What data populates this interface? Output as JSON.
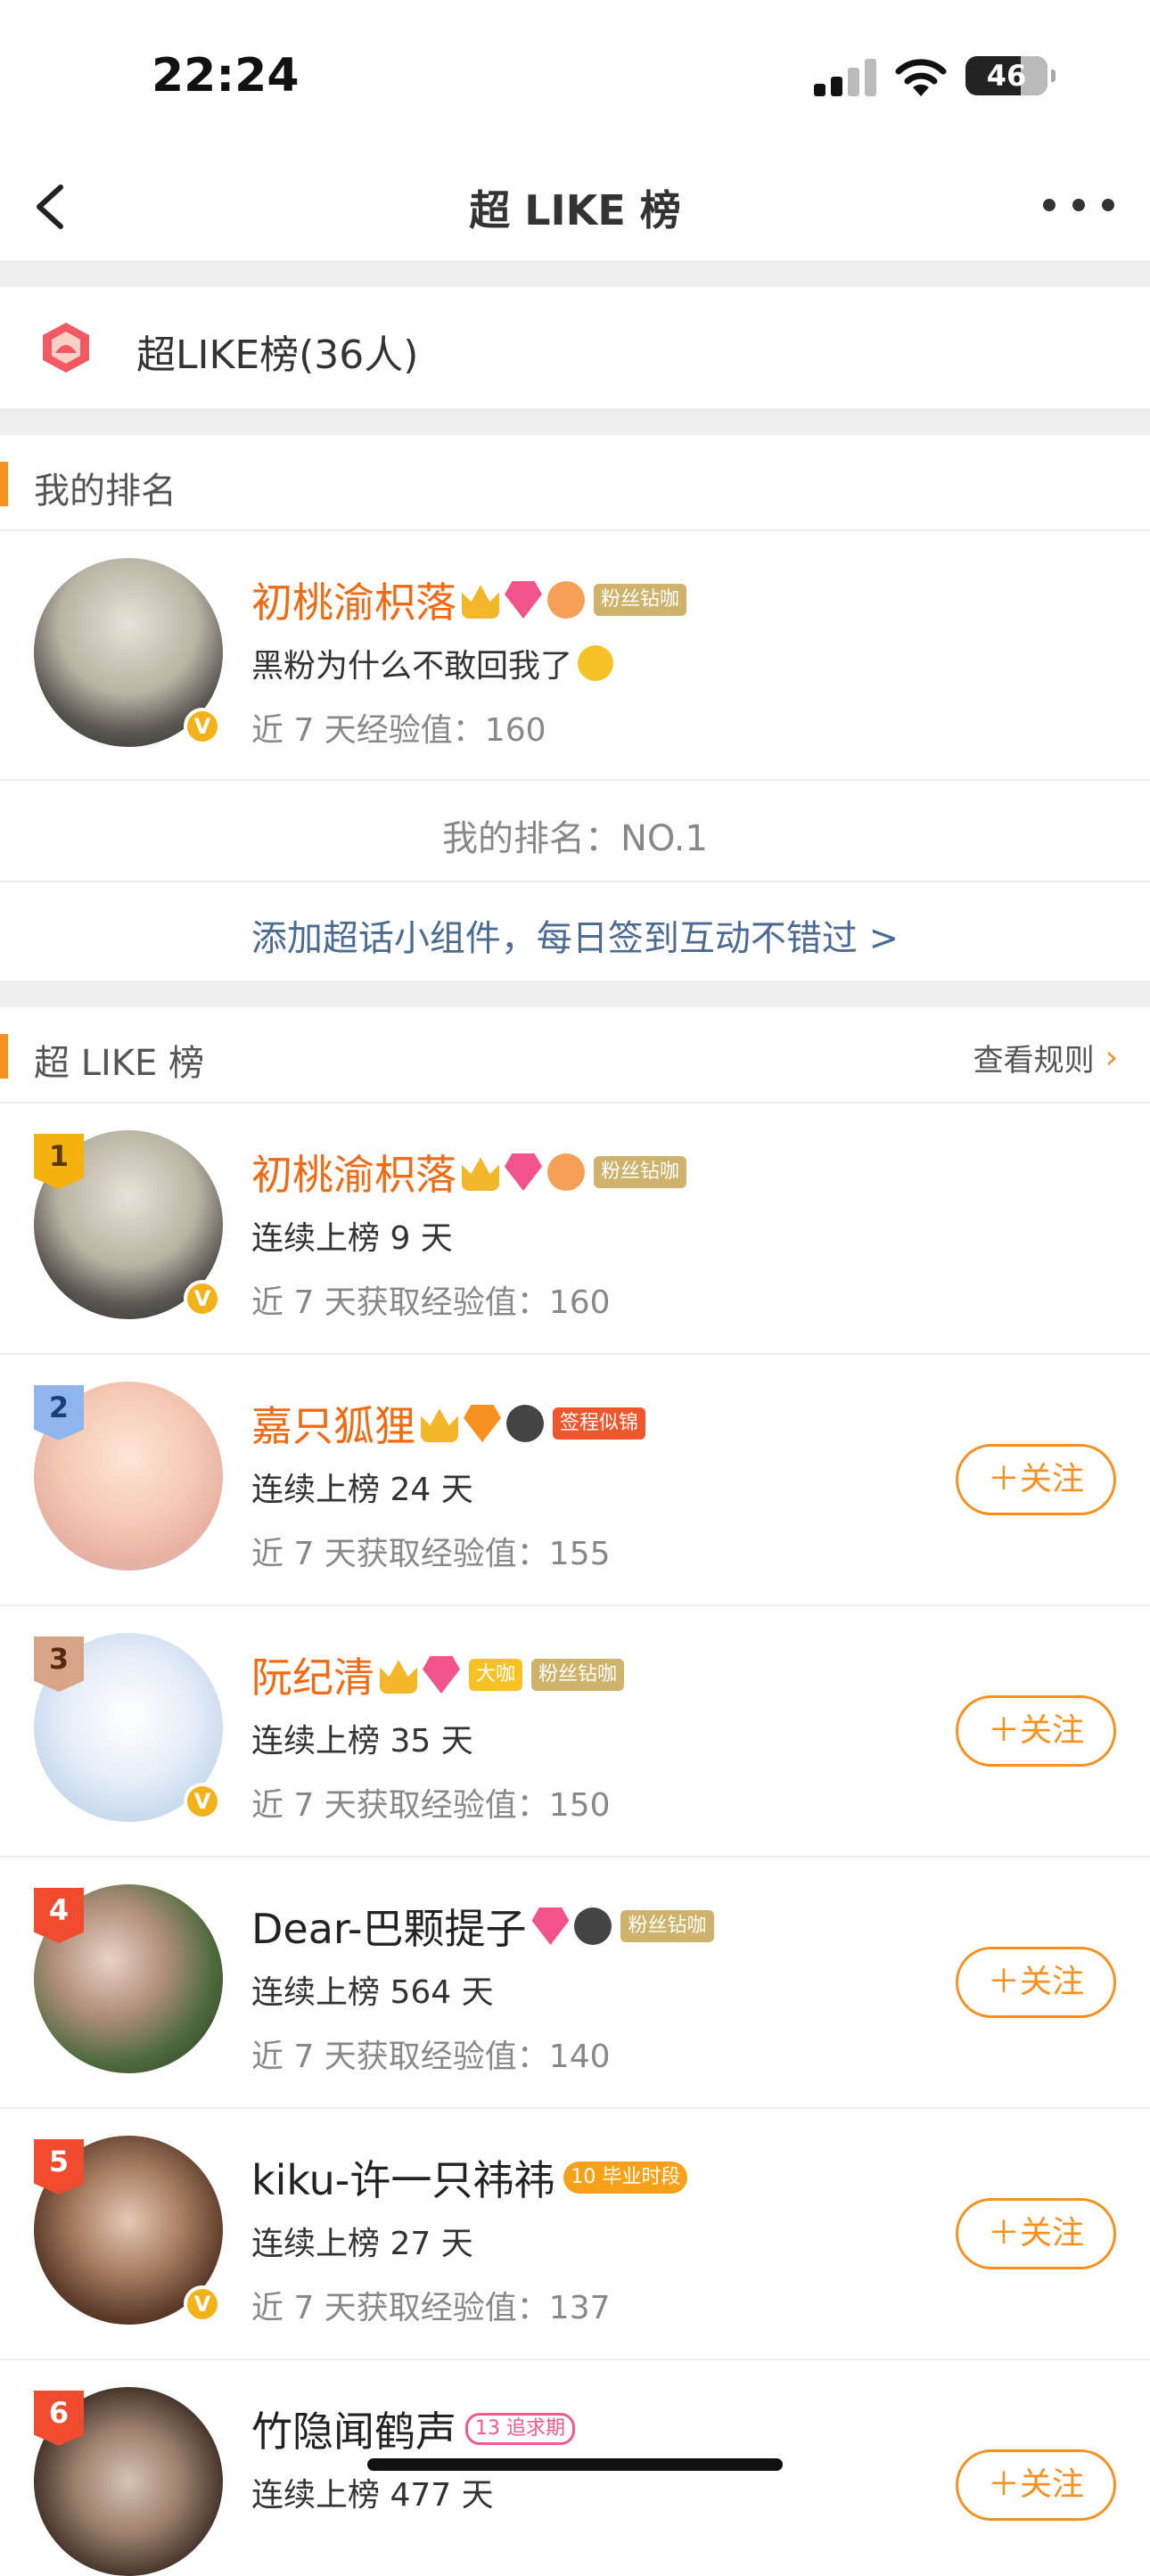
{
  "status": {
    "time": "22:24",
    "battery": "46"
  },
  "nav": {
    "title": "超 LIKE 榜"
  },
  "summary": {
    "text": "超LIKE榜(36人)"
  },
  "my_rank_section": {
    "title": "我的排名",
    "user": {
      "name": "初桃渝枳落",
      "tag": "粉丝钻咖",
      "bio": "黑粉为什么不敢回我了",
      "exp": "近 7 天经验值：160"
    },
    "rank_text": "我的排名：NO.1",
    "widget_link": "添加超话小组件，每日签到互动不错过 >"
  },
  "board": {
    "title": "超 LIKE 榜",
    "rules_label": "查看规则",
    "follow_label": "＋关注",
    "entries": [
      {
        "rank": "1",
        "name": "初桃渝枳落",
        "tags": [
          "粉丝钻咖"
        ],
        "streak": "连续上榜 9 天",
        "exp": "近 7 天获取经验值：160"
      },
      {
        "rank": "2",
        "name": "嘉只狐狸",
        "tags": [
          "签程似锦"
        ],
        "streak": "连续上榜 24 天",
        "exp": "近 7 天获取经验值：155"
      },
      {
        "rank": "3",
        "name": "阮纪清",
        "tags": [
          "大咖",
          "粉丝钻咖"
        ],
        "streak": "连续上榜 35 天",
        "exp": "近 7 天获取经验值：150"
      },
      {
        "rank": "4",
        "name": "Dear-巴颗提子",
        "tags": [
          "粉丝钻咖"
        ],
        "streak": "连续上榜 564 天",
        "exp": "近 7 天获取经验值：140"
      },
      {
        "rank": "5",
        "name": "kiku-许一只祎祎",
        "tags": [
          "10",
          "毕业时段"
        ],
        "streak": "连续上榜 27 天",
        "exp": "近 7 天获取经验值：137"
      },
      {
        "rank": "6",
        "name": "竹隐闻鹤声",
        "tags": [
          "13",
          "追求期"
        ],
        "streak": "连续上榜 477 天",
        "exp": ""
      }
    ]
  },
  "colors": {
    "accent": "#f7901e",
    "name_orange": "#f06a13",
    "divider": "#eeeeee"
  }
}
